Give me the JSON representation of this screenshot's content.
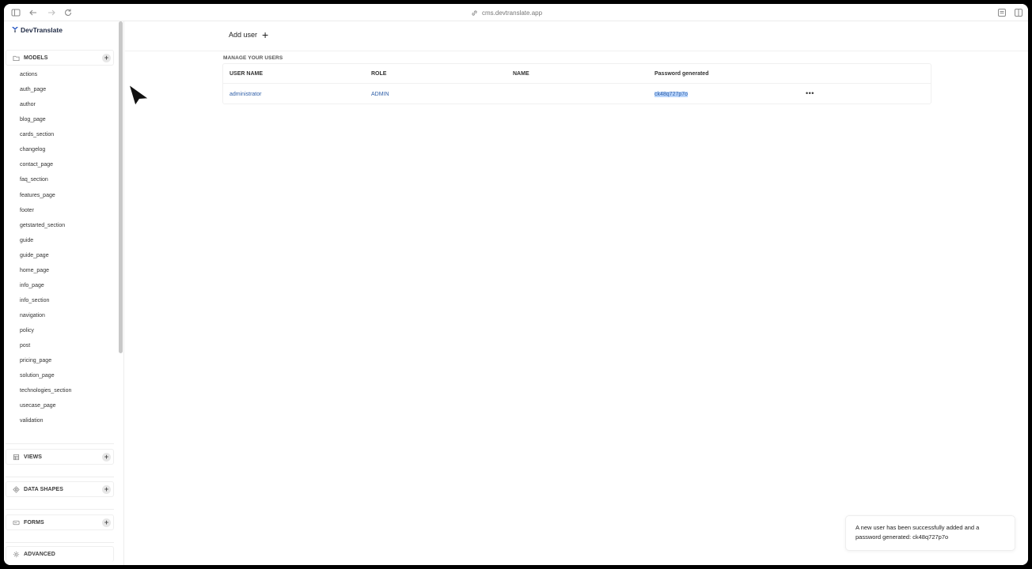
{
  "browser": {
    "url": "cms.devtranslate.app"
  },
  "sidebar": {
    "brand": "DevTranslate",
    "models": {
      "label": "MODELS",
      "items": [
        "actions",
        "auth_page",
        "author",
        "blog_page",
        "cards_section",
        "changelog",
        "contact_page",
        "faq_section",
        "features_page",
        "footer",
        "getstarted_section",
        "guide",
        "guide_page",
        "home_page",
        "info_page",
        "info_section",
        "navigation",
        "policy",
        "post",
        "pricing_page",
        "solution_page",
        "technologies_section",
        "usecase_page",
        "validation"
      ]
    },
    "views_label": "VIEWS",
    "data_shapes_label": "DATA SHAPES",
    "forms_label": "FORMS",
    "advanced_label": "ADVANCED"
  },
  "main": {
    "add_user_label": "Add user",
    "manage_title": "MANAGE YOUR USERS",
    "table": {
      "headers": [
        "USER NAME",
        "ROLE",
        "NAME",
        "Password generated"
      ],
      "rows": [
        {
          "user_name": "administrator",
          "role": "ADMIN",
          "name": "",
          "password": "ck48q727p7o",
          "menu": "•••"
        }
      ]
    }
  },
  "toast": {
    "line1": "A new user has been successfully added and a",
    "line2": "password generated: ck48q727p7o"
  },
  "colors": {
    "link": "#2f5fa8",
    "highlight": "#b9d5fb"
  }
}
